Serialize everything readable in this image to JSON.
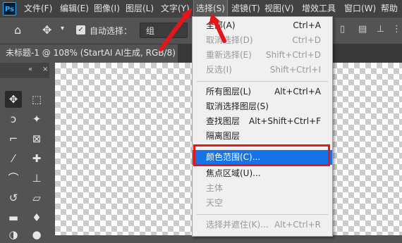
{
  "app": {
    "logo": "Ps"
  },
  "menubar": {
    "items": [
      "文件(F)",
      "编辑(E)",
      "图像(I)",
      "图层(L)",
      "文字(Y)",
      "选择(S)",
      "滤镜(T)",
      "视图(V)",
      "增效工具",
      "窗口(W)",
      "帮助"
    ],
    "active": "选择(S)"
  },
  "options": {
    "auto_select_label": "自动选择：",
    "auto_select_value": "组",
    "auto_select_checked": true
  },
  "document_tab": {
    "title": "未标题-1 @ 108% (StartAI AI生成, RGB/8) *",
    "close": "×"
  },
  "toolbox": {
    "collapse": "«",
    "close": "×"
  },
  "select_menu": {
    "groups": [
      [
        {
          "label": "全部(A)",
          "shortcut": "Ctrl+A",
          "enabled": true
        },
        {
          "label": "取消选择(D)",
          "shortcut": "Ctrl+D",
          "enabled": false
        },
        {
          "label": "重新选择(E)",
          "shortcut": "Shift+Ctrl+D",
          "enabled": false
        },
        {
          "label": "反选(I)",
          "shortcut": "Shift+Ctrl+I",
          "enabled": false
        }
      ],
      [
        {
          "label": "所有图层(L)",
          "shortcut": "Alt+Ctrl+A",
          "enabled": true
        },
        {
          "label": "取消选择图层(S)",
          "shortcut": "",
          "enabled": true
        },
        {
          "label": "查找图层",
          "shortcut": "Alt+Shift+Ctrl+F",
          "enabled": true
        },
        {
          "label": "隔离图层",
          "shortcut": "",
          "enabled": true
        }
      ],
      [
        {
          "label": "颜色范围(C)...",
          "shortcut": "",
          "enabled": true,
          "highlighted": true
        },
        {
          "label": "焦点区域(U)...",
          "shortcut": "",
          "enabled": true
        },
        {
          "label": "主体",
          "shortcut": "",
          "enabled": false
        },
        {
          "label": "天空",
          "shortcut": "",
          "enabled": false
        }
      ],
      [
        {
          "label": "选择并遮住(K)...",
          "shortcut": "Alt+Ctrl+R",
          "enabled": false
        }
      ]
    ]
  },
  "colors": {
    "highlight": "#1473e6",
    "annotation_red": "#e4161c"
  }
}
